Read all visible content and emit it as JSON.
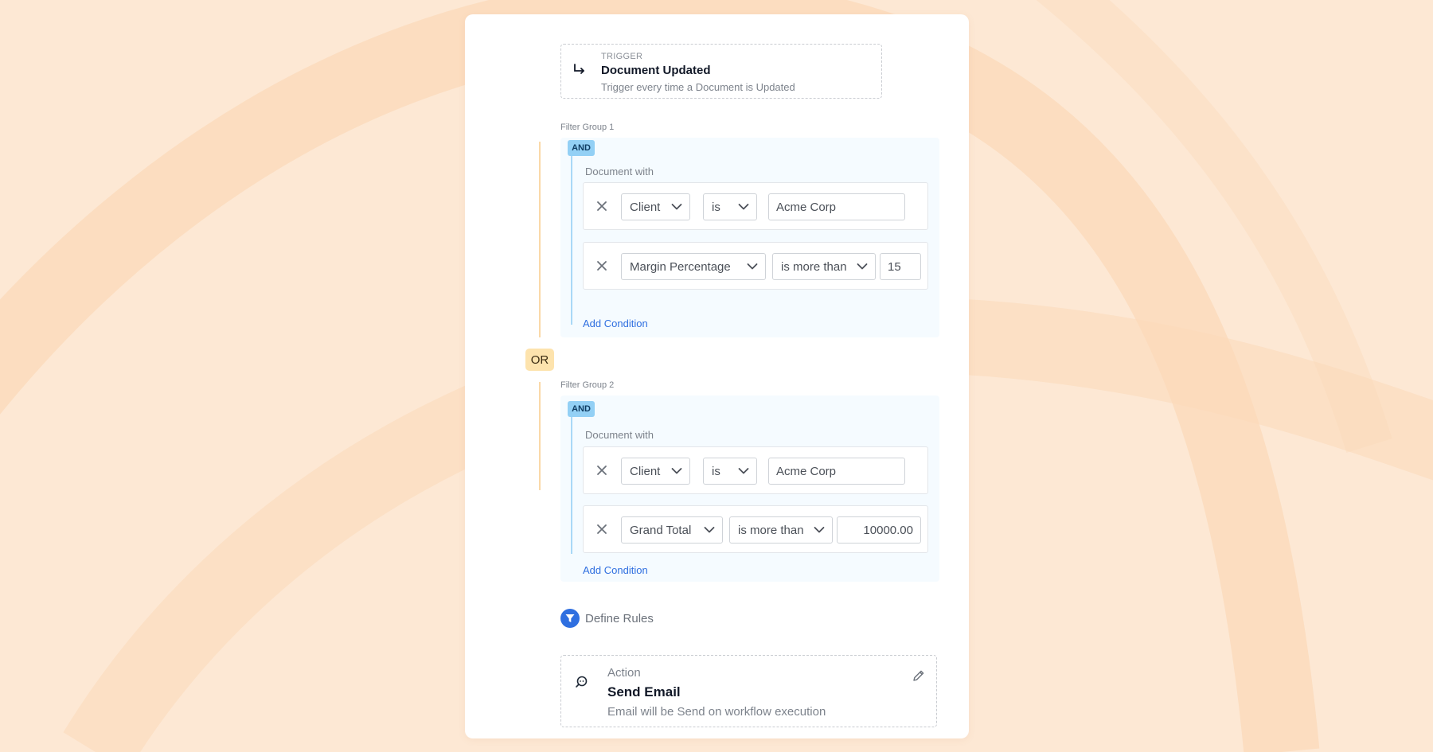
{
  "trigger": {
    "eyebrow": "TRIGGER",
    "title": "Document Updated",
    "description": "Trigger every time a  Document is Updated",
    "icon": "return-arrow-icon"
  },
  "groups": [
    {
      "label": "Filter Group 1",
      "operator": "AND",
      "subtitle": "Document with",
      "conditions": [
        {
          "field": "Client",
          "op": "is",
          "value": "Acme Corp"
        },
        {
          "field": "Margin Percentage",
          "op": "is more than",
          "value": "15"
        }
      ],
      "add_label": "Add Condition"
    },
    {
      "label": "Filter Group 2",
      "operator": "AND",
      "subtitle": "Document with",
      "conditions": [
        {
          "field": "Client",
          "op": "is",
          "value": "Acme Corp"
        },
        {
          "field": "Grand Total",
          "op": "is more than",
          "value": "10000.00"
        }
      ],
      "add_label": "Add Condition"
    }
  ],
  "or_label": "OR",
  "define_rules": {
    "label": "Define Rules",
    "icon": "filter-icon"
  },
  "action": {
    "eyebrow": "Action",
    "title": "Send Email",
    "description": "Email will be Send on workflow execution",
    "icon": "chat-icon",
    "edit_icon": "pencil-icon"
  },
  "colors": {
    "background": "#fde8d4",
    "accent": "#2f6fe0",
    "and_badge": "#93d0f5",
    "or_badge": "#fde3ad",
    "group_line": "#fad9a8"
  }
}
